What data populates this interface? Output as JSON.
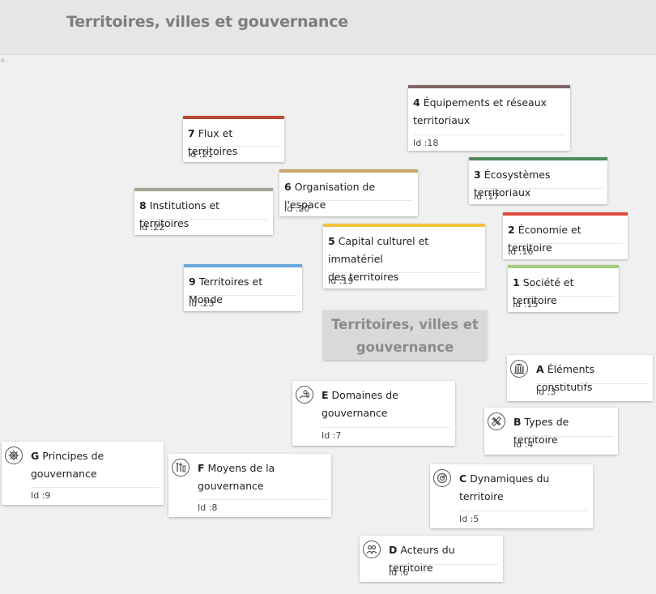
{
  "header": {
    "title": "Territoires, villes et gouvernance"
  },
  "center": {
    "line1": "Territoires, villes et",
    "line2": "gouvernance"
  },
  "colors": {
    "c1": "#a6d07e",
    "c2": "#e04a3a",
    "c3": "#4f8a5c",
    "c4": "#7b6665",
    "c5": "#f5c33b",
    "c6": "#c8a96a",
    "c7": "#b94a33",
    "c8": "#a6a594",
    "c9": "#6aa8dd"
  },
  "cards": {
    "c4": {
      "num": "4",
      "l1": "Équipements et réseaux",
      "l2": "territoriaux",
      "id": "Id :18"
    },
    "c7": {
      "num": "7",
      "l1": "Flux et territoires",
      "id": "Id :21"
    },
    "c3": {
      "num": "3",
      "l1": "Écosystèmes territoriaux",
      "id": "Id :17"
    },
    "c6": {
      "num": "6",
      "l1": "Organisation de l'espace",
      "id": "Id :20"
    },
    "c8": {
      "num": "8",
      "l1": "Institutions et territoires",
      "id": "Id :22"
    },
    "c2": {
      "num": "2",
      "l1": "Économie et territoire",
      "id": "Id :16"
    },
    "c5": {
      "num": "5",
      "l1": "Capital culturel et immatériel",
      "l2": "des territoires",
      "id": "Id :19"
    },
    "c9": {
      "num": "9",
      "l1": "Territoires et Monde",
      "id": "Id :23"
    },
    "c1": {
      "num": "1",
      "l1": "Société et territoire",
      "id": "Id :15"
    },
    "cA": {
      "num": "A",
      "l1": "Éléments constitutifs",
      "id": "Id :3",
      "icon": "columns-icon"
    },
    "cE": {
      "num": "E",
      "l1": "Domaines de",
      "l2": "gouvernance",
      "id": "Id :7",
      "icon": "hand-coins-icon"
    },
    "cB": {
      "num": "B",
      "l1": "Types de territoire",
      "id": "Id :4",
      "icon": "pencil-ruler-icon"
    },
    "cG": {
      "num": "G",
      "l1": "Principes de",
      "l2": "gouvernance",
      "id": "Id :9",
      "icon": "ship-wheel-icon"
    },
    "cF": {
      "num": "F",
      "l1": "Moyens de la",
      "l2": "gouvernance",
      "id": "Id :8",
      "icon": "tools-icon"
    },
    "cC": {
      "num": "C",
      "l1": "Dynamiques du",
      "l2": "territoire",
      "id": "Id :5",
      "icon": "gauge-icon"
    },
    "cD": {
      "num": "D",
      "l1": "Acteurs du territoire",
      "id": "Id :6",
      "icon": "people-icon"
    }
  }
}
